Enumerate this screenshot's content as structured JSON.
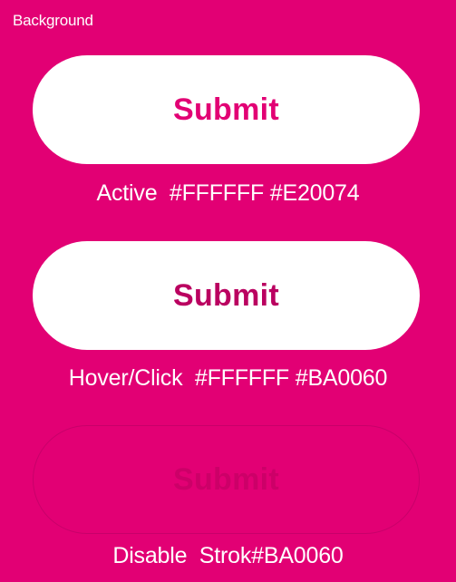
{
  "background_label": "Background",
  "colors": {
    "background": "#E20074",
    "button_fill": "#FFFFFF",
    "active_text": "#E20074",
    "hover_text": "#BA0060",
    "disabled_stroke": "#BA0060"
  },
  "states": {
    "active": {
      "button_label": "Submit",
      "caption": "Active  #FFFFFF #E20074"
    },
    "hover": {
      "button_label": "Submit",
      "caption": "Hover/Click  #FFFFFF #BA0060"
    },
    "disabled": {
      "button_label": "Submit",
      "caption": "Disable  Strok#BA0060"
    }
  }
}
